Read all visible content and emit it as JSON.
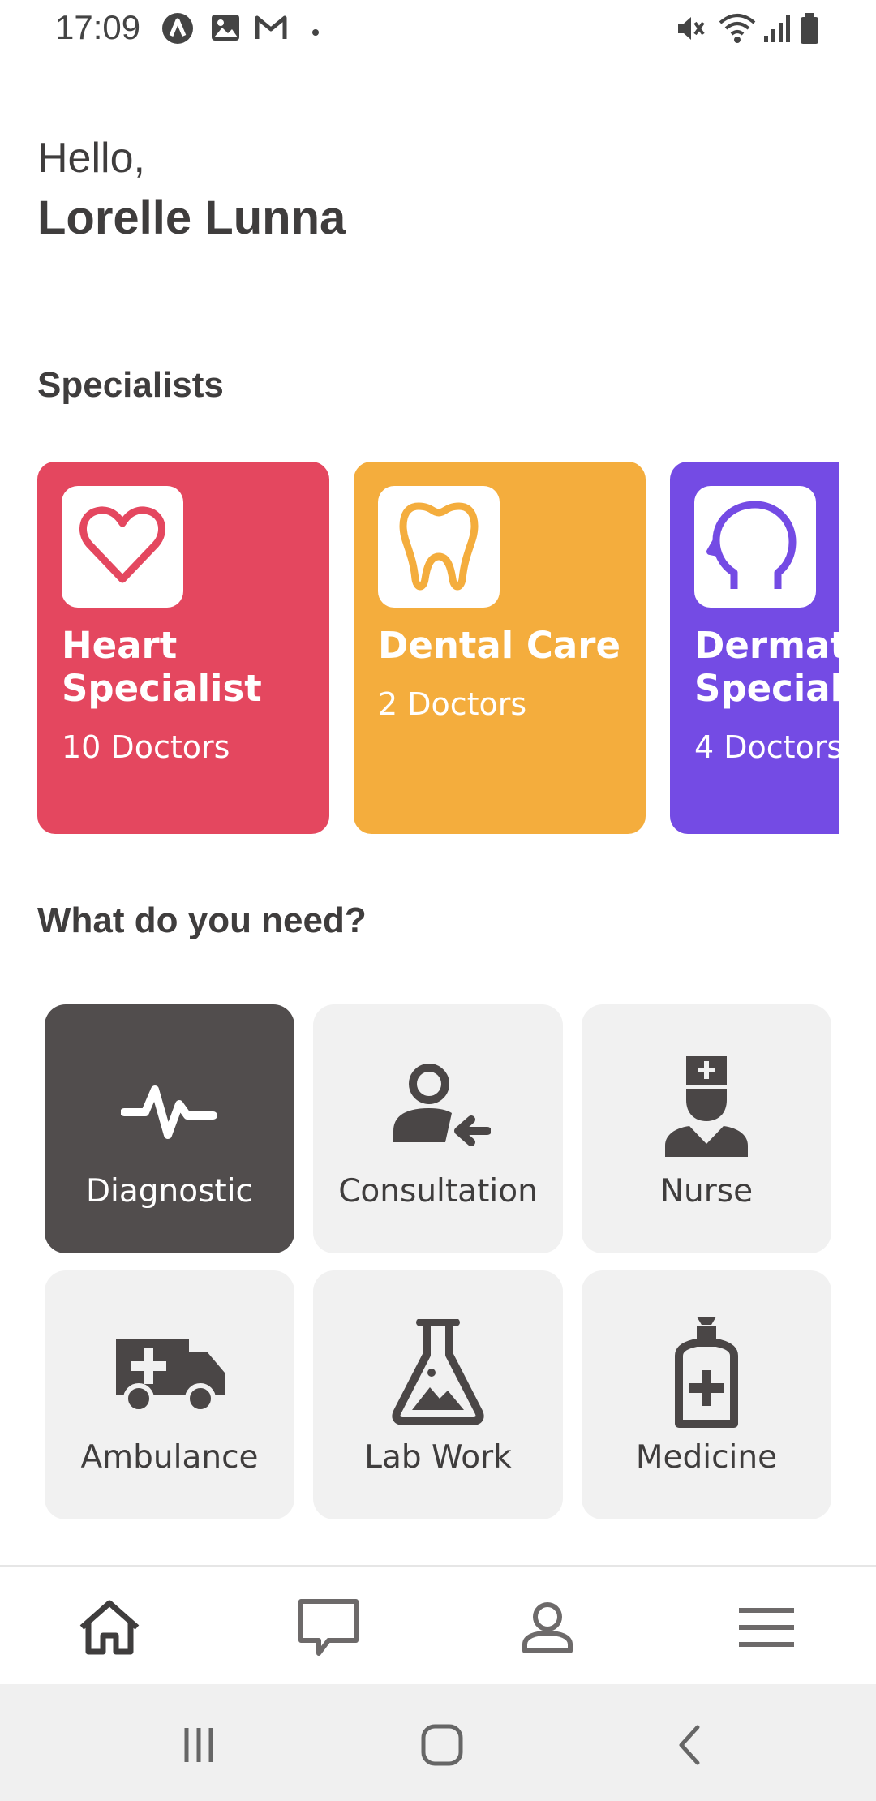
{
  "status_bar": {
    "time": "17:09",
    "left_icons": [
      "app-icon",
      "gallery-icon",
      "gmail-icon",
      "dot-icon"
    ],
    "right_icons": [
      "mute-icon",
      "wifi-icon",
      "signal-icon",
      "battery-icon"
    ]
  },
  "greeting": {
    "hello": "Hello,",
    "name": "Lorelle Lunna"
  },
  "specialists": {
    "title": "Specialists",
    "items": [
      {
        "name": "Heart\nSpecialist",
        "count": "10 Doctors",
        "color": "#e4475f",
        "icon": "heart-icon"
      },
      {
        "name": "Dental Care",
        "count": "2 Doctors",
        "color": "#f4ad3d",
        "icon": "tooth-icon"
      },
      {
        "name": "Dermato\nSpecialist",
        "count": "4 Doctors",
        "color": "#744be4",
        "icon": "head-icon"
      }
    ]
  },
  "needs": {
    "title": "What do you need?",
    "items": [
      {
        "label": "Diagnostic",
        "icon": "pulse-icon",
        "active": true
      },
      {
        "label": "Consultation",
        "icon": "consultation-icon",
        "active": false
      },
      {
        "label": "Nurse",
        "icon": "nurse-icon",
        "active": false
      },
      {
        "label": "Ambulance",
        "icon": "ambulance-icon",
        "active": false
      },
      {
        "label": "Lab Work",
        "icon": "flask-icon",
        "active": false
      },
      {
        "label": "Medicine",
        "icon": "medicine-bottle-icon",
        "active": false
      }
    ]
  },
  "bottom_nav": [
    "home-icon",
    "chat-icon",
    "profile-icon",
    "menu-icon"
  ],
  "system_nav": [
    "recent-apps-icon",
    "home-button-icon",
    "back-icon"
  ]
}
